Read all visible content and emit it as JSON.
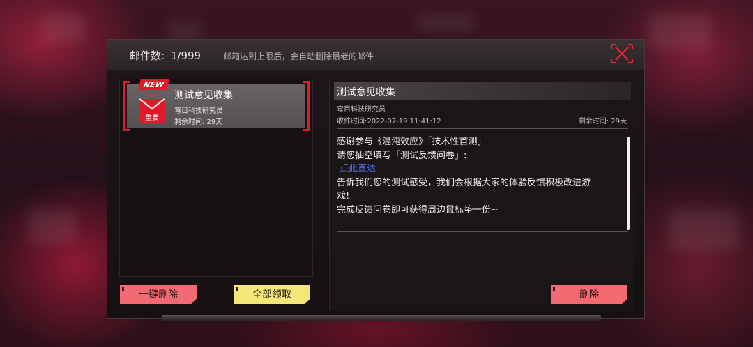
{
  "header": {
    "count_label": "邮件数:",
    "count_value": "1/999",
    "note": "邮箱达到上限后，会自动删除最老的邮件"
  },
  "mail_list": [
    {
      "badge": "NEW",
      "tag": "重要",
      "title": "测试意见收集",
      "sender": "穹目科技研究员",
      "remaining": "剩余时间:  29天"
    }
  ],
  "actions": {
    "delete_all": "一键删除",
    "claim_all": "全部领取",
    "delete": "删除"
  },
  "detail": {
    "title": "测试意见收集",
    "sender": "穹目科技研究员",
    "received": "收件时间:2022-07-19 11:41:12",
    "remaining": "剩余时间:  29天",
    "body": [
      "感谢参与《混沌效应》「技术性首测」",
      " 请您抽空填写「测试反馈问卷」:",
      "点此直达",
      " 告诉我们您的测试感受，我们会根据大家的体验反馈积极改进游",
      "戏!",
      " 完成反馈问卷即可获得周边鼠标垫一份~"
    ]
  },
  "colors": {
    "accent_red": "#e01a2a",
    "button_red": "#f26b72",
    "button_yellow": "#f5e679",
    "link_blue": "#5a6cf0"
  },
  "icons": {
    "close": "close-x-icon",
    "mail": "envelope-icon"
  }
}
